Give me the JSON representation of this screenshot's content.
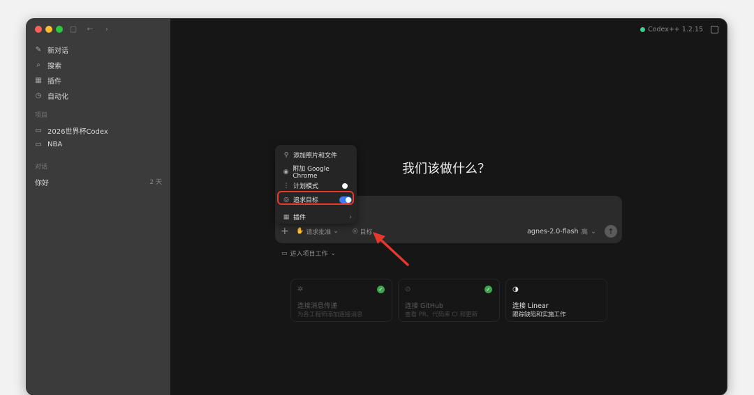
{
  "app": {
    "version_label": "Codex++ 1.2.15"
  },
  "sidebar": {
    "nav": [
      {
        "label": "新对话",
        "icon": "edit-icon"
      },
      {
        "label": "搜索",
        "icon": "search-icon"
      },
      {
        "label": "插件",
        "icon": "grid-icon"
      },
      {
        "label": "自动化",
        "icon": "clock-icon"
      }
    ],
    "projects_label": "项目",
    "projects": [
      {
        "label": "2026世界杯Codex",
        "icon": "folder-icon"
      },
      {
        "label": "NBA",
        "icon": "folder-icon"
      }
    ],
    "chats_label": "对话",
    "chats": [
      {
        "label": "你好",
        "ago": "2 天"
      }
    ]
  },
  "main": {
    "headline": "我们该做什么？",
    "composer": {
      "permission_label": "请求批准",
      "goal_label": "目标",
      "model_label": "agnes-2.0-flash",
      "effort_label": "高"
    },
    "project_button_label": "进入项目工作"
  },
  "popup": {
    "items": [
      {
        "label": "添加照片和文件",
        "icon": "paperclip-icon"
      },
      {
        "label": "附加 Google Chrome",
        "icon": "chrome-icon"
      },
      {
        "label": "计划模式",
        "icon": "plan-icon",
        "toggle": "off"
      },
      {
        "label": "追求目标",
        "icon": "target-icon",
        "toggle": "on"
      },
      {
        "label": "插件",
        "icon": "grid-icon",
        "has_submenu": true
      }
    ]
  },
  "cards": [
    {
      "title": "连接消息传递",
      "desc": "为各工程师添加连接消息",
      "checked": true,
      "icon": "sparkle-icon"
    },
    {
      "title": "连接 GitHub",
      "desc": "查看 PR、代码库 CI 和更新",
      "checked": true,
      "icon": "github-icon"
    },
    {
      "title": "连接 Linear",
      "desc": "跟踪缺陷和实施工作",
      "checked": false,
      "icon": "linear-icon"
    }
  ],
  "colors": {
    "accent_toggle": "#3d7cf2",
    "highlight": "#e6392b",
    "check": "#3fa34d"
  }
}
